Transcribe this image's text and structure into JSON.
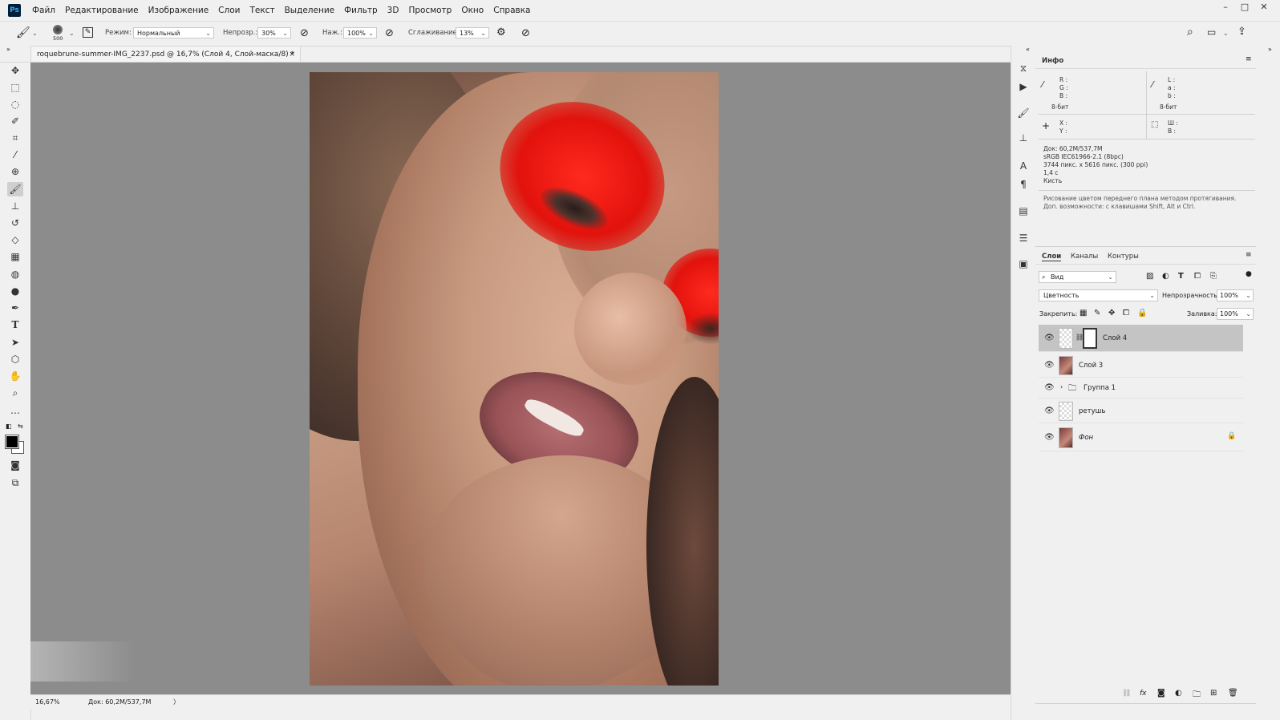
{
  "menubar": {
    "logo": "Ps",
    "items": [
      "Файл",
      "Редактирование",
      "Изображение",
      "Слои",
      "Текст",
      "Выделение",
      "Фильтр",
      "3D",
      "Просмотр",
      "Окно",
      "Справка"
    ],
    "window_controls": [
      "–",
      "□",
      "✕"
    ]
  },
  "options": {
    "brush_size": "500",
    "mode_label": "Режим:",
    "mode_value": "Нормальный",
    "opacity_label": "Непрозр.:",
    "opacity_value": "30%",
    "pressure_label": "Наж.:",
    "pressure_value": "100%",
    "smoothing_label": "Сглаживание:",
    "smoothing_value": "13%"
  },
  "document": {
    "tab_title": "roquebrune-summer-IMG_2237.psd @ 16,7% (Слой 4, Слой-маска/8) *",
    "close": "×",
    "zoom": "16,67%",
    "doc_size": "Док: 60,2M/537,7M",
    "status_arrow": "〉"
  },
  "info_panel": {
    "title": "Инфо",
    "rgb_labels": "R :\nG :\nB :",
    "lab_labels": "L :\na :\nb :",
    "bit_left": "8-бит",
    "bit_right": "8-бит",
    "xy_labels": "X :\nY :",
    "wh_labels": "Ш :\nВ :",
    "doc_lines": [
      "Док: 60,2M/537,7M",
      "sRGB IEC61966-2.1 (8bpc)",
      "3744 пикс. x 5616 пикс. (300 ppi)",
      "1,4 с",
      "Кисть"
    ],
    "hint_lines": [
      "Рисование цветом переднего плана методом протягивания.",
      "Доп. возможности: с клавишами Shift, Alt и Ctrl."
    ]
  },
  "layers_panel": {
    "tabs": [
      "Слои",
      "Каналы",
      "Контуры"
    ],
    "filter_placeholder": "Вид",
    "blend_mode": "Цветность",
    "opacity_label": "Непрозрачность:",
    "opacity_value": "100%",
    "lock_label": "Закрепить:",
    "fill_label": "Заливка:",
    "fill_value": "100%",
    "layers": [
      {
        "name": "Слой 4"
      },
      {
        "name": "Слой 3"
      },
      {
        "name": "Группа 1"
      },
      {
        "name": "ретушь"
      },
      {
        "name": "Фон"
      }
    ]
  },
  "icons": {
    "tools": [
      "move-icon",
      "marquee-icon",
      "lasso-icon",
      "quick-select-icon",
      "crop-icon",
      "eyedropper-icon",
      "healing-icon",
      "brush-icon",
      "stamp-icon",
      "history-brush-icon",
      "eraser-icon",
      "gradient-icon",
      "blur-icon",
      "dodge-icon",
      "pen-icon",
      "type-icon",
      "path-select-icon",
      "shape-icon",
      "hand-icon",
      "zoom-icon",
      "more-icon"
    ]
  },
  "colors": {
    "canvas_bg": "#8c8c8c",
    "ui_bg": "#f0f0f0",
    "selected_layer": "#c4c4c4",
    "eyeshadow": "#e2120c"
  }
}
